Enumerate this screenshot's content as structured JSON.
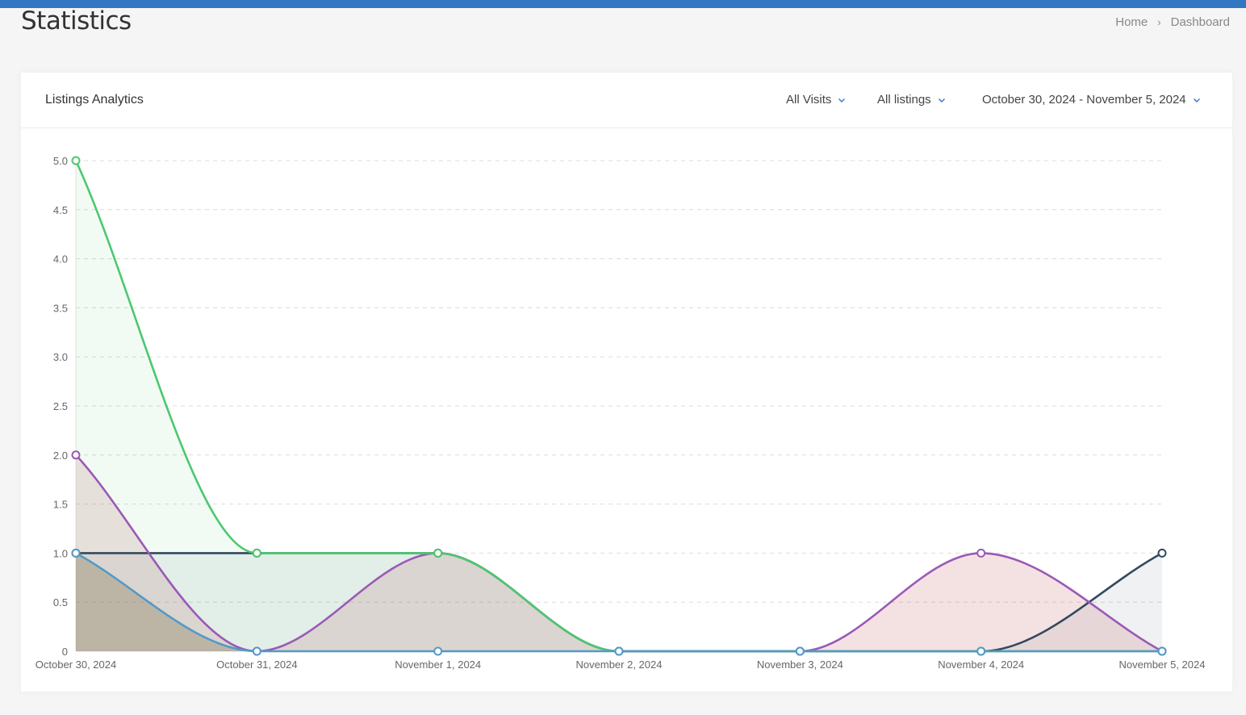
{
  "header": {
    "title": "Statistics",
    "breadcrumb": {
      "home": "Home",
      "current": "Dashboard"
    }
  },
  "card": {
    "title": "Listings Analytics",
    "filters": {
      "visits": "All Visits",
      "listings": "All listings",
      "date_range": "October 30, 2024 - November 5, 2024"
    }
  },
  "colors": {
    "topbar": "#3377c2",
    "series_green": "#4cc86e",
    "series_purple": "#9b59b6",
    "series_navy": "#34495e",
    "series_blue": "#5499c7"
  },
  "chart_data": {
    "type": "area",
    "x": [
      "October 30, 2024",
      "October 31, 2024",
      "November 1, 2024",
      "November 2, 2024",
      "November 3, 2024",
      "November 4, 2024",
      "November 5, 2024"
    ],
    "y_ticks": [
      "0",
      "0.5",
      "1.0",
      "1.5",
      "2.0",
      "2.5",
      "3.0",
      "3.5",
      "4.0",
      "4.5",
      "5.0"
    ],
    "ylim": [
      0,
      5
    ],
    "grid": true,
    "series": [
      {
        "color": "#34495e",
        "fill": "rgba(52,73,94,0.08)",
        "values": [
          1,
          1,
          1,
          0,
          0,
          0,
          1
        ]
      },
      {
        "color": "#9b59b6",
        "fill": "rgba(180,60,70,0.15)",
        "values": [
          2,
          0,
          1,
          0,
          0,
          1,
          0
        ]
      },
      {
        "color": "#4cc86e",
        "fill": "rgba(76,200,110,0.08)",
        "values": [
          5,
          1,
          1,
          0,
          0,
          0,
          0
        ]
      },
      {
        "color": "#5499c7",
        "fill": "rgba(120,110,70,0.3)",
        "values": [
          1,
          0,
          0,
          0,
          0,
          0,
          0
        ]
      }
    ]
  }
}
